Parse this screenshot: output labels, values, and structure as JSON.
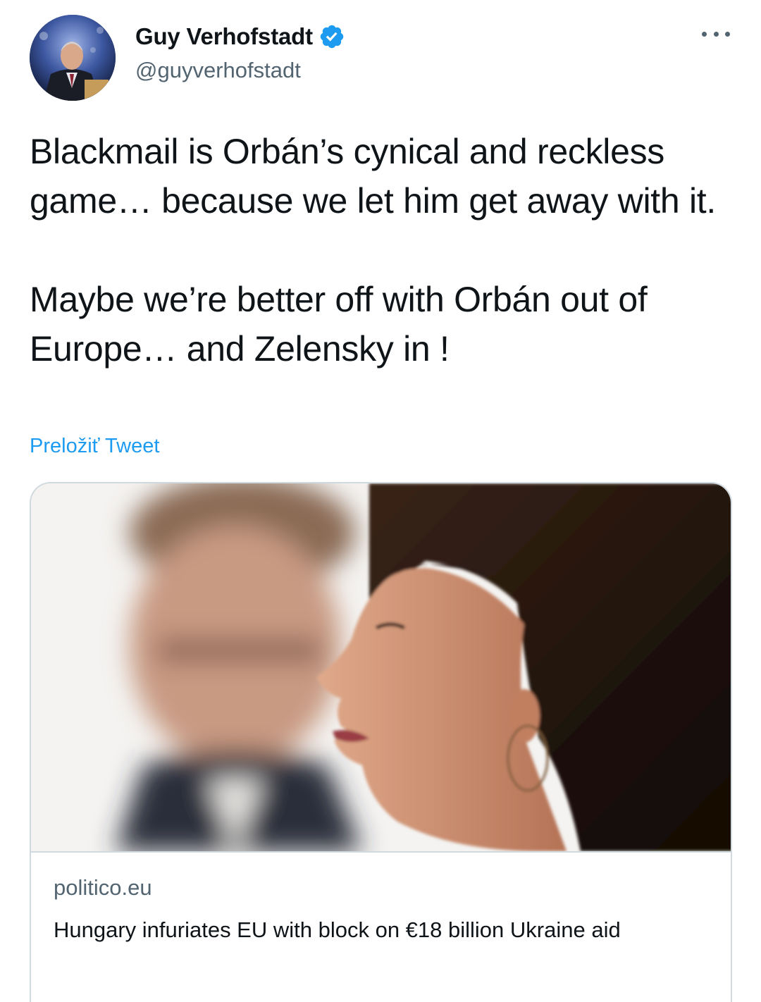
{
  "author": {
    "name": "Guy Verhofstadt",
    "handle": "@guyverhofstadt",
    "verified": true
  },
  "tweet": {
    "paragraphs": [
      "Blackmail is Orbán’s cynical and reckless game… because we let him get away with it.",
      "Maybe we’re better off with Orbán out of Europe… and Zelensky in !"
    ],
    "translate_label": "Preložiť Tweet"
  },
  "card": {
    "domain": "politico.eu",
    "title": "Hungary infuriates EU with block on €18 billion Ukraine aid"
  },
  "icons": {
    "verified": "verified-badge-icon",
    "more": "more-options-icon"
  },
  "colors": {
    "link": "#1d9bf0",
    "secondary_text": "#536471",
    "primary_text": "#0f1419",
    "border": "#cfd9de"
  }
}
